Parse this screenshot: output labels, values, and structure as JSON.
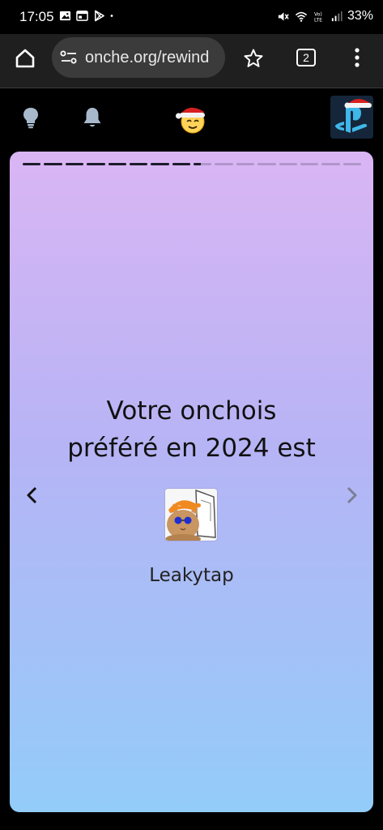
{
  "status_bar": {
    "time": "17:05",
    "battery": "33%",
    "icons_left": [
      "gallery-icon",
      "calendar-icon",
      "play-store-icon",
      "dot-icon"
    ],
    "icons_right": [
      "mute-icon",
      "wifi-icon",
      "volte-icon",
      "signal-icon"
    ]
  },
  "browser": {
    "url": "onche.org/rewind",
    "tab_count": "2"
  },
  "site_header": {
    "icons": [
      "lightbulb-icon",
      "bell-icon",
      "santa-smiley-logo",
      "user-avatar"
    ]
  },
  "story": {
    "progress": {
      "segments": 16,
      "completed": 8,
      "current_fill": 0.4
    },
    "heading_line1": "Votre onchois",
    "heading_line2": "préféré en 2024 est",
    "username": "Leakytap",
    "colors": {
      "gradient_top": "#dab5f4",
      "gradient_bottom": "#93ccf9"
    }
  }
}
